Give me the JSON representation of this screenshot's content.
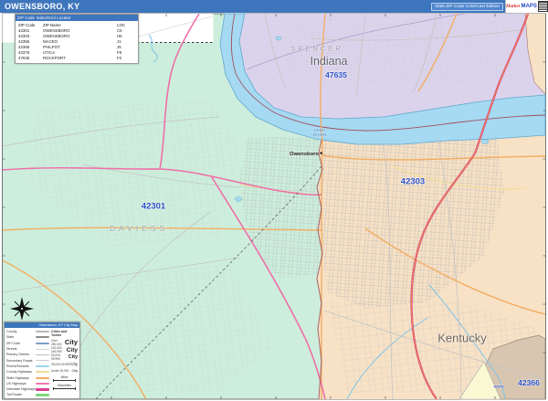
{
  "header": {
    "title": "OWENSBORO, KY",
    "edition": "2026 ZIP Code ColorCast Edition",
    "logo": {
      "brand_top": "Market",
      "brand_bottom": "MAPS"
    }
  },
  "index_panel": {
    "title": "ZIP Code Index/Grid Locator",
    "columns": [
      "ZIP Code",
      "ZIP Name",
      "LOC"
    ],
    "rows": [
      [
        "42301",
        "OWENSBORO",
        "C5"
      ],
      [
        "42303",
        "OWENSBORO",
        "H5"
      ],
      [
        "42355",
        "MACEO",
        "J1"
      ],
      [
        "42366",
        "PHILPOT",
        "J5"
      ],
      [
        "42376",
        "UTICA",
        "F8"
      ],
      [
        "47635",
        "ROCKPORT",
        "F2"
      ]
    ]
  },
  "map": {
    "labels": {
      "county_north": "SPENCER",
      "state_north": "Indiana",
      "zip_north": "47635",
      "river": "OHIO RIVER",
      "city": "Owensboro",
      "zip_west": "42301",
      "county_west": "DAVIESS",
      "zip_east": "42303",
      "state_south": "Kentucky",
      "zip_southeast": "42366",
      "zip_southeast_small": "42376"
    },
    "colors": {
      "zip_42301": "#cdeedd",
      "zip_42303": "#f8e2c6",
      "indiana": "#dbd3eb",
      "river": "#a6d9f2",
      "zip_42366": "#d8c6b0",
      "zip_42376": "#fbf9d4",
      "zip_label": "#2b50c8",
      "us_highway": "#d84090",
      "state_highway": "#f3ad62",
      "pink_highway": "#ef6fa8"
    }
  },
  "legend": {
    "title": "Owensboro, KY City Map",
    "items": [
      {
        "label": "County",
        "color": "#b8b8b8",
        "weight": 1.5
      },
      {
        "label": "State",
        "color": "#8a8a8a",
        "weight": 2
      },
      {
        "label": "ZIP Code",
        "color": "#7d9cc8",
        "weight": 2
      },
      {
        "label": "Streets",
        "color": "#d5d5d5",
        "weight": 1
      },
      {
        "label": "Primary Streets",
        "color": "#c0c0c0",
        "weight": 1.5
      },
      {
        "label": "Secondary Roads",
        "color": "#cccccc",
        "weight": 1
      },
      {
        "label": "Rivers/Streams",
        "color": "#9ed3ee",
        "weight": 1.5
      },
      {
        "label": "County Highways",
        "color": "#f0dc96",
        "weight": 2
      },
      {
        "label": "State Highways",
        "color": "#f3ad62",
        "weight": 2
      },
      {
        "label": "US Highways",
        "color": "#f078ad",
        "weight": 2.5
      },
      {
        "label": "Interstate Highways",
        "color": "#d84090",
        "weight": 3
      },
      {
        "label": "Toll Roads",
        "color": "#7ed87e",
        "weight": 2.5
      }
    ],
    "cities_title": "Cities and Towns",
    "city_sizes": [
      {
        "range": "Over 250,000",
        "sample": "City"
      },
      {
        "range": "100,000-249,999",
        "sample": "City"
      },
      {
        "range": "50,000-99,999",
        "sample": "City"
      },
      {
        "range": "25,000-49,999",
        "sample": "City"
      },
      {
        "range": "Under 25,000",
        "sample": "City"
      }
    ],
    "scale_miles": "Miles",
    "scale_km": "Kilometers"
  }
}
